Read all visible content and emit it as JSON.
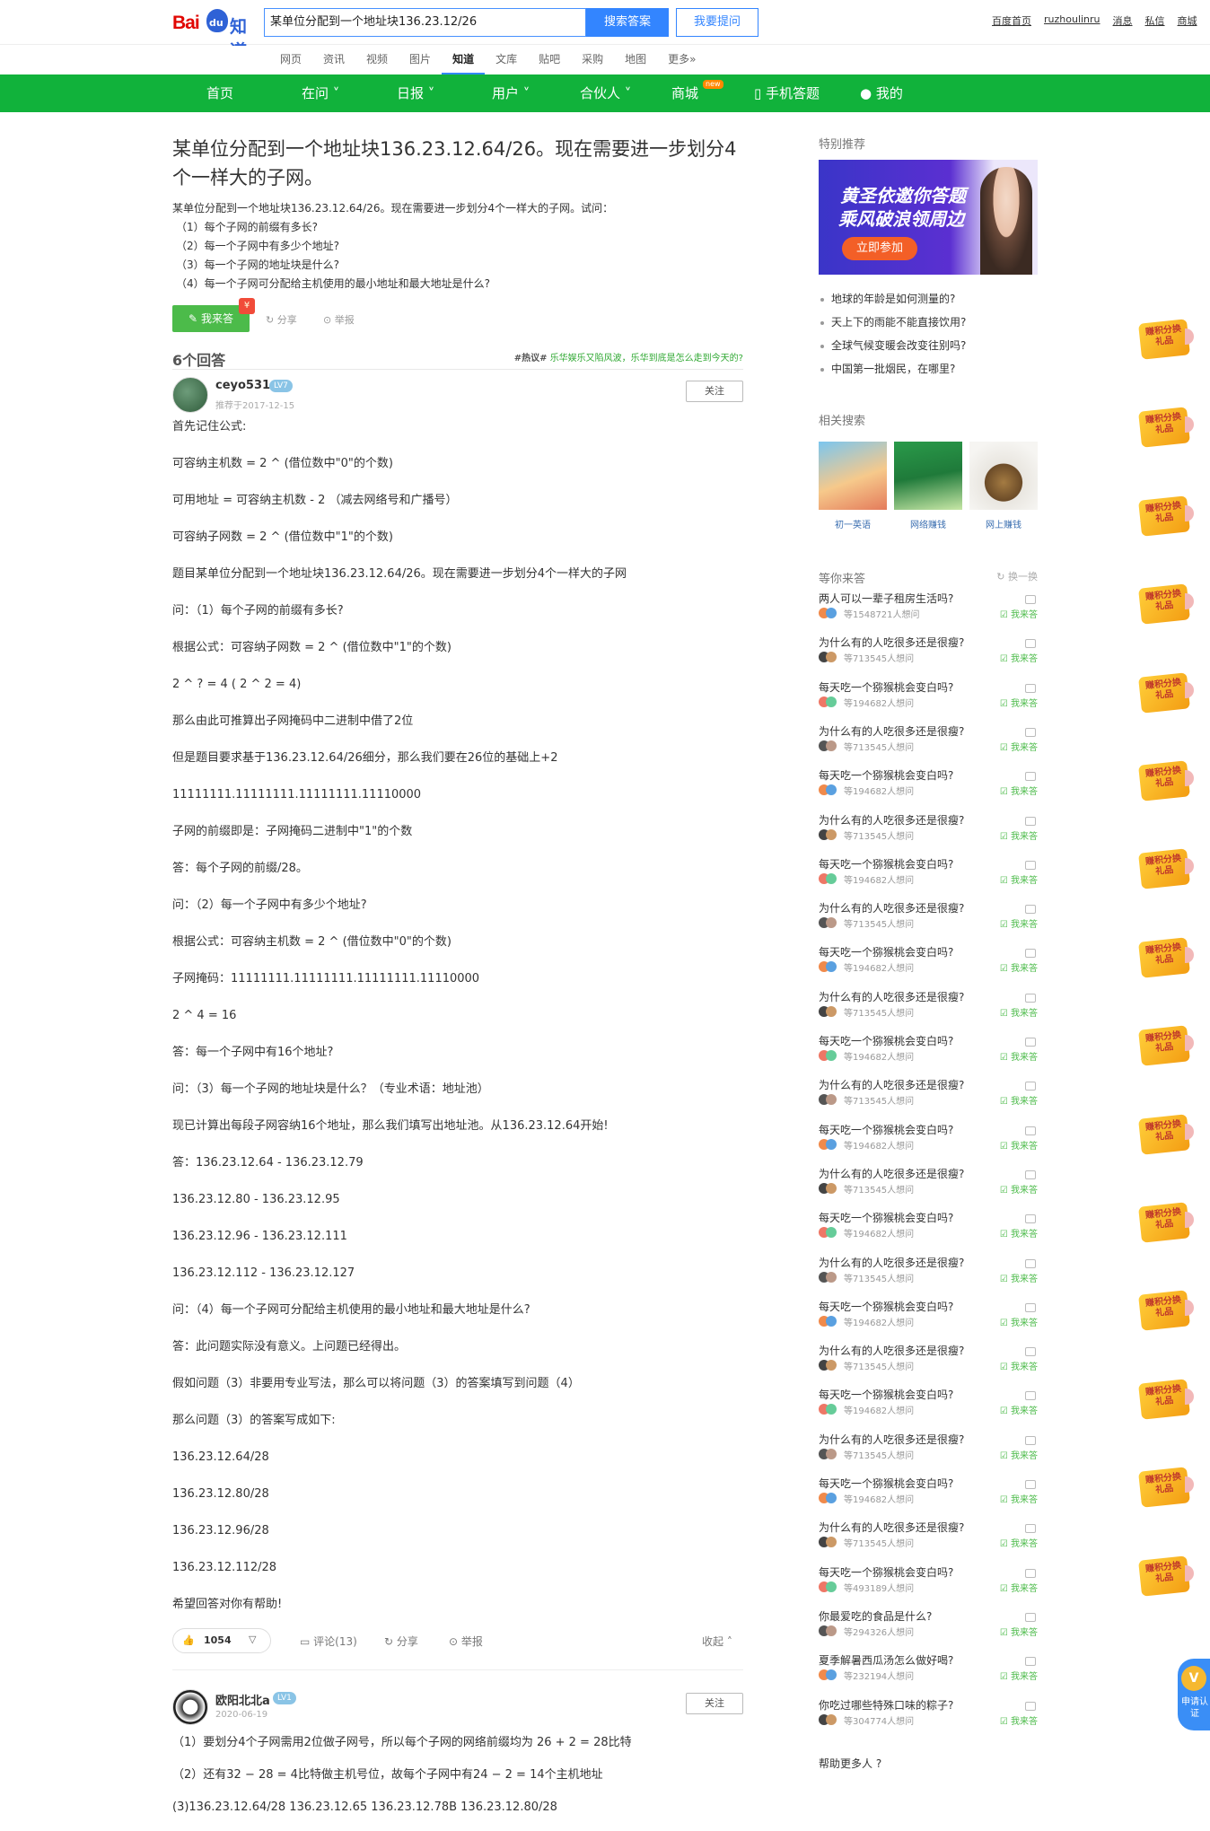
{
  "header": {
    "logo_bai": "Bai",
    "logo_du": "du",
    "logo_zhidao": "知道",
    "search_value": "某单位分配到一个地址块136.23.12/26",
    "search_button": "搜索答案",
    "ask_button": "我要提问",
    "links": [
      "百度首页",
      "ruzhoulinru",
      "消息",
      "私信",
      "商城"
    ]
  },
  "channels": [
    "网页",
    "资讯",
    "视频",
    "图片",
    "知道",
    "文库",
    "贴吧",
    "采购",
    "地图",
    "更多»"
  ],
  "active_channel": "知道",
  "green_nav": {
    "home": "首页",
    "zaiwen": "在问",
    "ribao": "日报",
    "user": "用户",
    "partner": "合伙人",
    "mall": "商城",
    "mall_badge": "new",
    "mobile": "手机答题",
    "mine": "我的"
  },
  "question": {
    "title_line1": "某单位分配到一个地址块136.23.12.64/26。现在需要进一步划分4",
    "title_line2": "个一样大的子网。",
    "desc": [
      "某单位分配到一个地址块136.23.12.64/26。现在需要进一步划分4个一样大的子网。试问：",
      "（1）每个子网的前缀有多长?",
      "（2）每一个子网中有多少个地址?",
      "（3）每一个子网的地址块是什么?",
      "（4）每一个子网可分配给主机使用的最小地址和最大地址是什么?"
    ],
    "answer_button": "我来答",
    "share": "分享",
    "report": "举报"
  },
  "answers_header": {
    "count": "6个回答",
    "hot_tag": "#热议#",
    "hot_text": "乐华娱乐又陷风波，乐华到底是怎么走到今天的?"
  },
  "answer1": {
    "user": "ceyo531",
    "level": "LV7",
    "date": "推荐于2017-12-15",
    "follow": "关注",
    "paragraphs": [
      "首先记住公式:",
      "可容纳主机数 = 2 ^ (借位数中\"0\"的个数)",
      "可用地址 = 可容纳主机数 - 2  （减去网络号和广播号）",
      "可容纳子网数 = 2 ^ (借位数中\"1\"的个数)",
      "题目某单位分配到一个地址块136.23.12.64/26。现在需要进一步划分4个一样大的子网",
      "问：（1）每个子网的前缀有多长?",
      "根据公式：可容纳子网数 = 2 ^ (借位数中\"1\"的个数)",
      "2 ^ ? = 4 ( 2 ^ 2 = 4)",
      "那么由此可推算出子网掩码中二进制中借了2位",
      "但是题目要求基于136.23.12.64/26细分，那么我们要在26位的基础上+2",
      "11111111.11111111.11111111.11110000",
      "子网的前缀即是：子网掩码二进制中\"1\"的个数",
      "答：每个子网的前缀/28。",
      "问：（2）每一个子网中有多少个地址?",
      "根据公式：可容纳主机数 = 2 ^ (借位数中\"0\"的个数)",
      "子网掩码：11111111.11111111.11111111.11110000",
      "2 ^ 4 = 16",
      "答：每一个子网中有16个地址?",
      "问：（3）每一个子网的地址块是什么？（专业术语：地址池）",
      "现已计算出每段子网容纳16个地址，那么我们填写出地址池。从136.23.12.64开始!",
      "答：136.23.12.64 - 136.23.12.79",
      "136.23.12.80 - 136.23.12.95",
      "136.23.12.96 - 136.23.12.111",
      "136.23.12.112 - 136.23.12.127",
      "问：（4）每一个子网可分配给主机使用的最小地址和最大地址是什么?",
      "答：此问题实际没有意义。上问题已经得出。",
      "假如问题（3）非要用专业写法，那么可以将问题（3）的答案填写到问题（4）",
      "那么问题（3）的答案写成如下:",
      "136.23.12.64/28",
      "136.23.12.80/28",
      "136.23.12.96/28",
      "136.23.12.112/28",
      "希望回答对你有帮助!"
    ],
    "likes": "1054",
    "comments": "评论(13)",
    "share": "分享",
    "report": "举报",
    "collapse": "收起"
  },
  "answer2": {
    "user": "欧阳北北a",
    "level": "LV1",
    "date": "2020-06-19",
    "follow": "关注",
    "paragraphs": [
      "（1）要划分4个子网需用2位做子网号，所以每个子网的网络前缀均为 26 + 2 = 28比特",
      "（2）还有32 − 28 = 4比特做主机号位，故每个子网中有24 − 2 = 14个主机地址",
      "(3)136.23.12.64/28 136.23.12.65 136.23.12.78B 136.23.12.80/28"
    ]
  },
  "sidebar": {
    "special_title": "特别推荐",
    "banner_line1": "黄圣依邀你答题",
    "banner_line2": "乘风破浪领周边",
    "banner_cta": "立即参加",
    "recommend": [
      "地球的年龄是如何测量的?",
      "天上下的雨能不能直接饮用?",
      "全球气候变暖会改变往别吗?",
      "中国第一批烟民，在哪里?"
    ],
    "related_title": "相关搜索",
    "related": [
      "初一英语",
      "网络赚钱",
      "网上赚钱"
    ],
    "waiting_title": "等你来答",
    "change": "换一换",
    "waiting": [
      {
        "q": "两人可以一辈子租房生活吗?",
        "n": "等1548721人想问"
      },
      {
        "q": "为什么有的人吃很多还是很瘦?",
        "n": "等713545人想问"
      },
      {
        "q": "每天吃一个猕猴桃会变白吗?",
        "n": "等194682人想问"
      },
      {
        "q": "为什么有的人吃很多还是很瘦?",
        "n": "等713545人想问"
      },
      {
        "q": "每天吃一个猕猴桃会变白吗?",
        "n": "等194682人想问"
      },
      {
        "q": "为什么有的人吃很多还是很瘦?",
        "n": "等713545人想问"
      },
      {
        "q": "每天吃一个猕猴桃会变白吗?",
        "n": "等194682人想问"
      },
      {
        "q": "为什么有的人吃很多还是很瘦?",
        "n": "等713545人想问"
      },
      {
        "q": "每天吃一个猕猴桃会变白吗?",
        "n": "等194682人想问"
      },
      {
        "q": "为什么有的人吃很多还是很瘦?",
        "n": "等713545人想问"
      },
      {
        "q": "每天吃一个猕猴桃会变白吗?",
        "n": "等194682人想问"
      },
      {
        "q": "为什么有的人吃很多还是很瘦?",
        "n": "等713545人想问"
      },
      {
        "q": "每天吃一个猕猴桃会变白吗?",
        "n": "等194682人想问"
      },
      {
        "q": "为什么有的人吃很多还是很瘦?",
        "n": "等713545人想问"
      },
      {
        "q": "每天吃一个猕猴桃会变白吗?",
        "n": "等194682人想问"
      },
      {
        "q": "为什么有的人吃很多还是很瘦?",
        "n": "等713545人想问"
      },
      {
        "q": "每天吃一个猕猴桃会变白吗?",
        "n": "等194682人想问"
      },
      {
        "q": "为什么有的人吃很多还是很瘦?",
        "n": "等713545人想问"
      },
      {
        "q": "每天吃一个猕猴桃会变白吗?",
        "n": "等194682人想问"
      },
      {
        "q": "为什么有的人吃很多还是很瘦?",
        "n": "等713545人想问"
      },
      {
        "q": "每天吃一个猕猴桃会变白吗?",
        "n": "等194682人想问"
      },
      {
        "q": "为什么有的人吃很多还是很瘦?",
        "n": "等713545人想问"
      },
      {
        "q": "每天吃一个猕猴桃会变白吗?",
        "n": "等493189人想问"
      },
      {
        "q": "你最爱吃的食品是什么?",
        "n": "等294326人想问"
      },
      {
        "q": "夏季解暑西瓜汤怎么做好喝?",
        "n": "等232194人想问"
      },
      {
        "q": "你吃过哪些特殊口味的粽子?",
        "n": "等304774人想问"
      }
    ],
    "answer_label": "我来答",
    "help_more": "帮助更多人"
  },
  "float": {
    "badge_text": "赚积分换礼品",
    "auth_text": "申请认证",
    "auth_icon": "V"
  }
}
